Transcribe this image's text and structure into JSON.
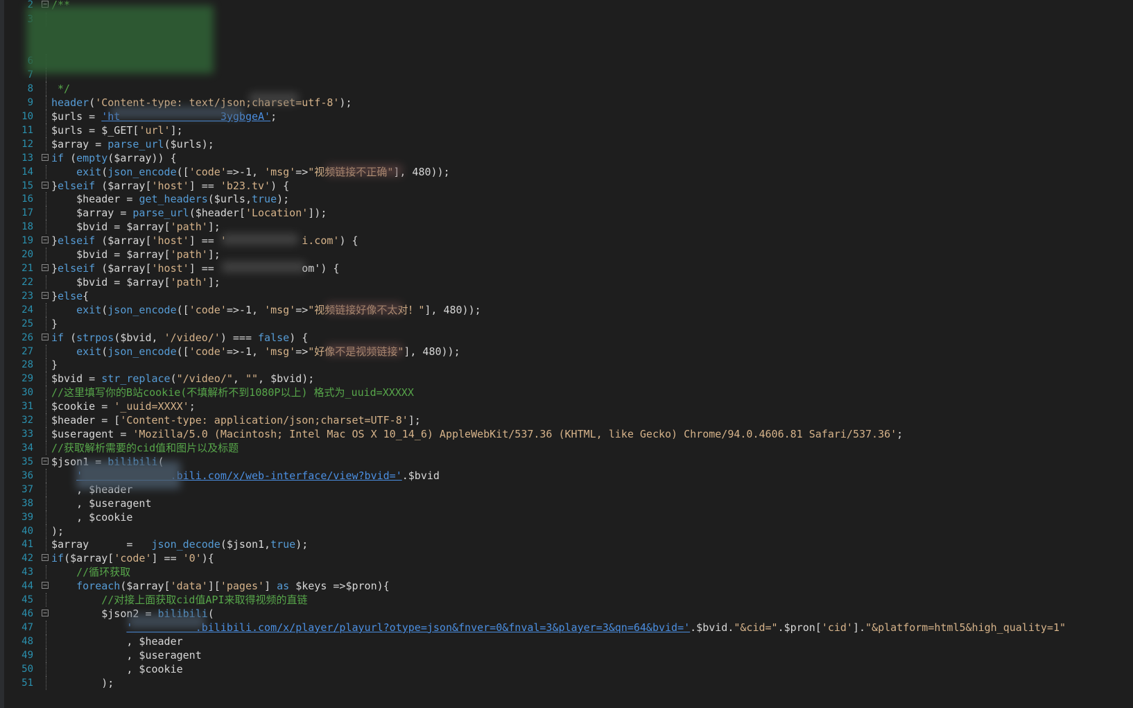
{
  "editor": {
    "lines": [
      {
        "n": "2",
        "fold": "⊟",
        "code": "/**",
        "cls": "cm"
      },
      {
        "n": "3",
        "code": ""
      },
      {
        "n": "6",
        "code": ""
      },
      {
        "n": "7",
        "code": ""
      },
      {
        "n": "8",
        "code": " */",
        "cls": "cm"
      },
      {
        "n": "9",
        "code": "header('Content-type: text/json;charset=utf-8');"
      },
      {
        "n": "10",
        "code": "$urls = 'ht                3ygbgeA';"
      },
      {
        "n": "11",
        "code": "$urls = $_GET['url'];"
      },
      {
        "n": "12",
        "code": "$array = parse_url($urls);"
      },
      {
        "n": "13",
        "fold": "⊟",
        "code": "if (empty($array)) {"
      },
      {
        "n": "14",
        "code": "    exit(json_encode(['code'=>-1, 'msg'=>\"视频链接不正确\"], 480));"
      },
      {
        "n": "15",
        "fold": "⊟",
        "code": "}elseif ($array['host'] == 'b23.tv') {"
      },
      {
        "n": "16",
        "code": "    $header = get_headers($urls,true);"
      },
      {
        "n": "17",
        "code": "    $array = parse_url($header['Location']);"
      },
      {
        "n": "18",
        "code": "    $bvid = $array['path'];"
      },
      {
        "n": "19",
        "fold": "⊟",
        "code": "}elseif ($array['host'] == '            i.com') {"
      },
      {
        "n": "20",
        "code": "    $bvid = $array['path'];"
      },
      {
        "n": "21",
        "fold": "⊟",
        "code": "}elseif ($array['host'] ==              om') {"
      },
      {
        "n": "22",
        "code": "    $bvid = $array['path'];"
      },
      {
        "n": "23",
        "fold": "⊟",
        "code": "}else{"
      },
      {
        "n": "24",
        "code": "    exit(json_encode(['code'=>-1, 'msg'=>\"视频链接好像不太对！\"], 480));"
      },
      {
        "n": "25",
        "code": "}"
      },
      {
        "n": "26",
        "fold": "⊟",
        "code": "if (strpos($bvid, '/video/') === false) {"
      },
      {
        "n": "27",
        "code": "    exit(json_encode(['code'=>-1, 'msg'=>\"好像不是视频链接\"], 480));"
      },
      {
        "n": "28",
        "code": "}"
      },
      {
        "n": "29",
        "code": "$bvid = str_replace(\"/video/\", \"\", $bvid);"
      },
      {
        "n": "30",
        "code": "//这里填写你的B站cookie(不填解析不到1080P以上) 格式为_uuid=XXXXX",
        "cls": "cm"
      },
      {
        "n": "31",
        "code": "$cookie = '_uuid=XXXX';"
      },
      {
        "n": "32",
        "code": "$header = ['Content-type: application/json;charset=UTF-8'];"
      },
      {
        "n": "33",
        "code": "$useragent = 'Mozilla/5.0 (Macintosh; Intel Mac OS X 10_14_6) AppleWebKit/537.36 (KHTML, like Gecko) Chrome/94.0.4606.81 Safari/537.36';"
      },
      {
        "n": "34",
        "code": "//获取解析需要的cid值和图片以及标题",
        "cls": "cm"
      },
      {
        "n": "35",
        "fold": "⊟",
        "code": "$json1 = bilibili("
      },
      {
        "n": "36",
        "code": "    '              .bili.com/x/web-interface/view?bvid='.$bvid"
      },
      {
        "n": "37",
        "code": "    , $header"
      },
      {
        "n": "38",
        "code": "    , $useragent"
      },
      {
        "n": "39",
        "code": "    , $cookie"
      },
      {
        "n": "40",
        "code": ");"
      },
      {
        "n": "41",
        "code": "$array      =   json_decode($json1,true);"
      },
      {
        "n": "42",
        "fold": "⊟",
        "code": "if($array['code'] == '0'){"
      },
      {
        "n": "43",
        "code": "    //循环获取",
        "cls": "cm"
      },
      {
        "n": "44",
        "fold": "⊟",
        "code": "    foreach($array['data']['pages'] as $keys =>$pron){"
      },
      {
        "n": "45",
        "code": "        //对接上面获取cid值API来取得视频的直链",
        "cls": "cm"
      },
      {
        "n": "46",
        "fold": "⊟",
        "code": "        $json2 = bilibili("
      },
      {
        "n": "47",
        "code": "            '          .bilibili.com/x/player/playurl?otype=json&fnver=0&fnval=3&player=3&qn=64&bvid='.$bvid.\"&cid=\".$pron['cid'].\"&platform=html5&high_quality=1\""
      },
      {
        "n": "48",
        "code": "            , $header"
      },
      {
        "n": "49",
        "code": "            , $useragent"
      },
      {
        "n": "50",
        "code": "            , $cookie"
      },
      {
        "n": "51",
        "code": "        );"
      }
    ]
  },
  "colors": {
    "background": "#1e1e1e",
    "line_number": "#2b91af",
    "keyword": "#569cd6",
    "string": "#d6b38a",
    "comment": "#57a64a",
    "link": "#4b8fe2"
  }
}
